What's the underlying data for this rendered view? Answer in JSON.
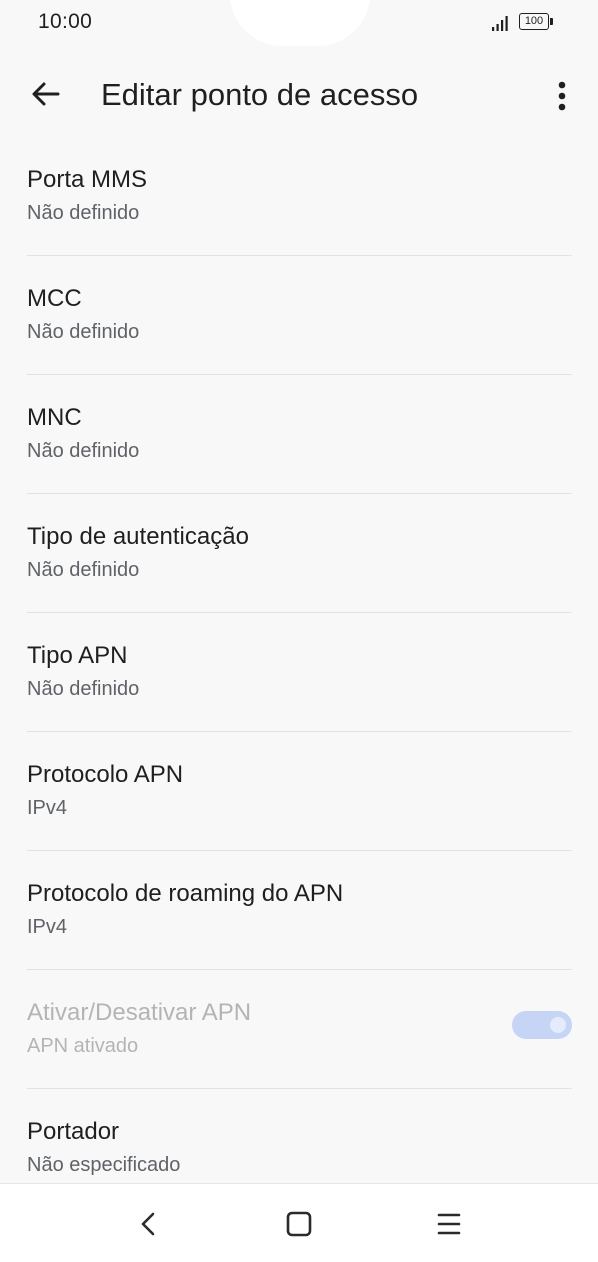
{
  "status_bar": {
    "time": "10:00",
    "battery": "100",
    "icons": [
      "signal-icon",
      "battery-icon"
    ]
  },
  "app_bar": {
    "title": "Editar ponto de acesso",
    "back_icon": "arrow-left-icon",
    "menu_icon": "more-vert-icon"
  },
  "settings": [
    {
      "label": "Porta MMS",
      "value": "Não definido"
    },
    {
      "label": "MCC",
      "value": "Não definido"
    },
    {
      "label": "MNC",
      "value": "Não definido"
    },
    {
      "label": "Tipo de autenticação",
      "value": "Não definido"
    },
    {
      "label": "Tipo APN",
      "value": "Não definido"
    },
    {
      "label": "Protocolo APN",
      "value": "IPv4"
    },
    {
      "label": "Protocolo de roaming do APN",
      "value": "IPv4"
    },
    {
      "label": "Ativar/Desativar APN",
      "value": "APN ativado",
      "toggle_on": true,
      "disabled": true
    },
    {
      "label": "Portador",
      "value": "Não especificado"
    }
  ],
  "colors": {
    "background": "#f8f8f8",
    "toggle_track": "#c6d4f6",
    "secondary_text": "#5f6368",
    "disabled_text": "#b4b4b4"
  },
  "nav_bar": {
    "icons": [
      "nav-back-icon",
      "nav-home-icon",
      "nav-recents-icon"
    ]
  }
}
